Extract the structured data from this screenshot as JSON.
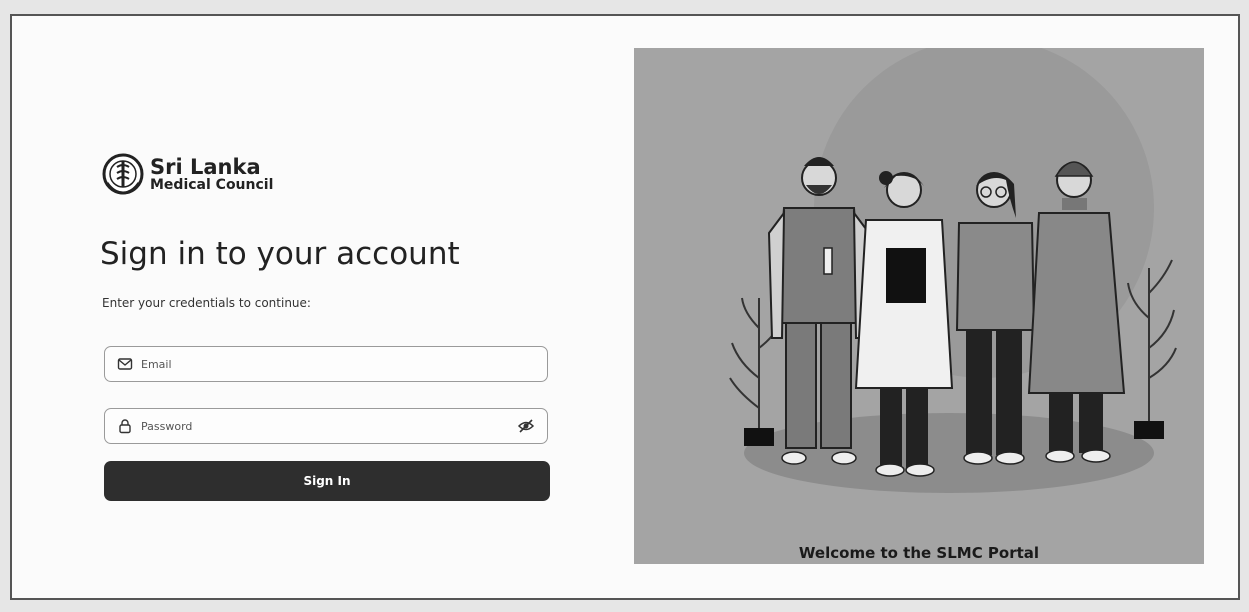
{
  "brand": {
    "name_line1": "Sri Lanka",
    "name_line2": "Medical Council",
    "logo_icon": "slmc-crest-icon"
  },
  "signin": {
    "title": "Sign in to your account",
    "subtitle": "Enter your credentials to continue:",
    "email_placeholder": "Email",
    "email_icon": "mail-icon",
    "password_placeholder": "Password",
    "password_icon": "lock-icon",
    "visibility_icon": "eye-off-icon",
    "button_label": "Sign In"
  },
  "illustration": {
    "caption": "Welcome to the SLMC Portal",
    "image_icon": "medical-staff-illustration"
  },
  "colors": {
    "button_bg": "#2e2e2e",
    "panel_bg": "#a4a4a4",
    "text": "#222222"
  }
}
